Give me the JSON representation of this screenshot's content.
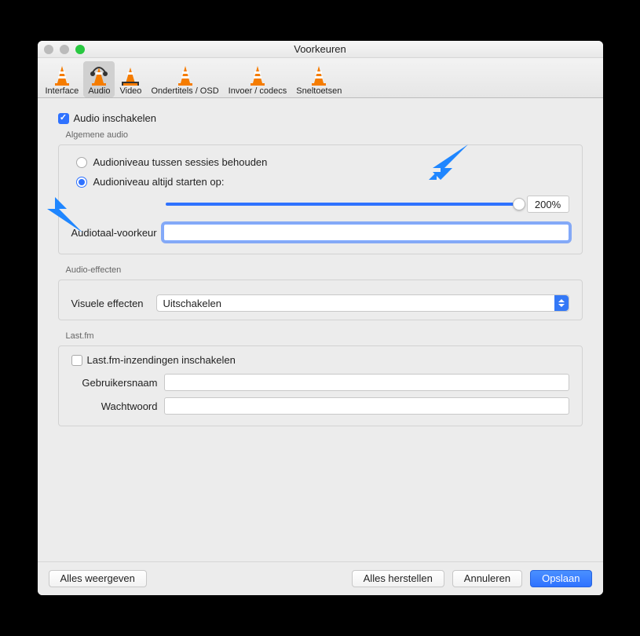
{
  "window": {
    "title": "Voorkeuren"
  },
  "toolbar": {
    "items": [
      {
        "label": "Interface"
      },
      {
        "label": "Audio"
      },
      {
        "label": "Video"
      },
      {
        "label": "Ondertitels / OSD"
      },
      {
        "label": "Invoer / codecs"
      },
      {
        "label": "Sneltoetsen"
      }
    ]
  },
  "audio": {
    "enable_label": "Audio inschakelen",
    "general_title": "Algemene audio",
    "radio_keep": "Audioniveau tussen sessies behouden",
    "radio_start": "Audioniveau altijd starten op:",
    "slider_value": "200%",
    "lang_label": "Audiotaal-voorkeur",
    "lang_value": ""
  },
  "effects": {
    "section_title": "Audio-effecten",
    "visual_label": "Visuele effecten",
    "visual_selected": "Uitschakelen"
  },
  "lastfm": {
    "section_title": "Last.fm",
    "enable_label": "Last.fm-inzendingen inschakelen",
    "user_label": "Gebruikersnaam",
    "pass_label": "Wachtwoord",
    "user_value": "",
    "pass_value": ""
  },
  "buttons": {
    "show_all": "Alles weergeven",
    "reset": "Alles herstellen",
    "cancel": "Annuleren",
    "save": "Opslaan"
  }
}
